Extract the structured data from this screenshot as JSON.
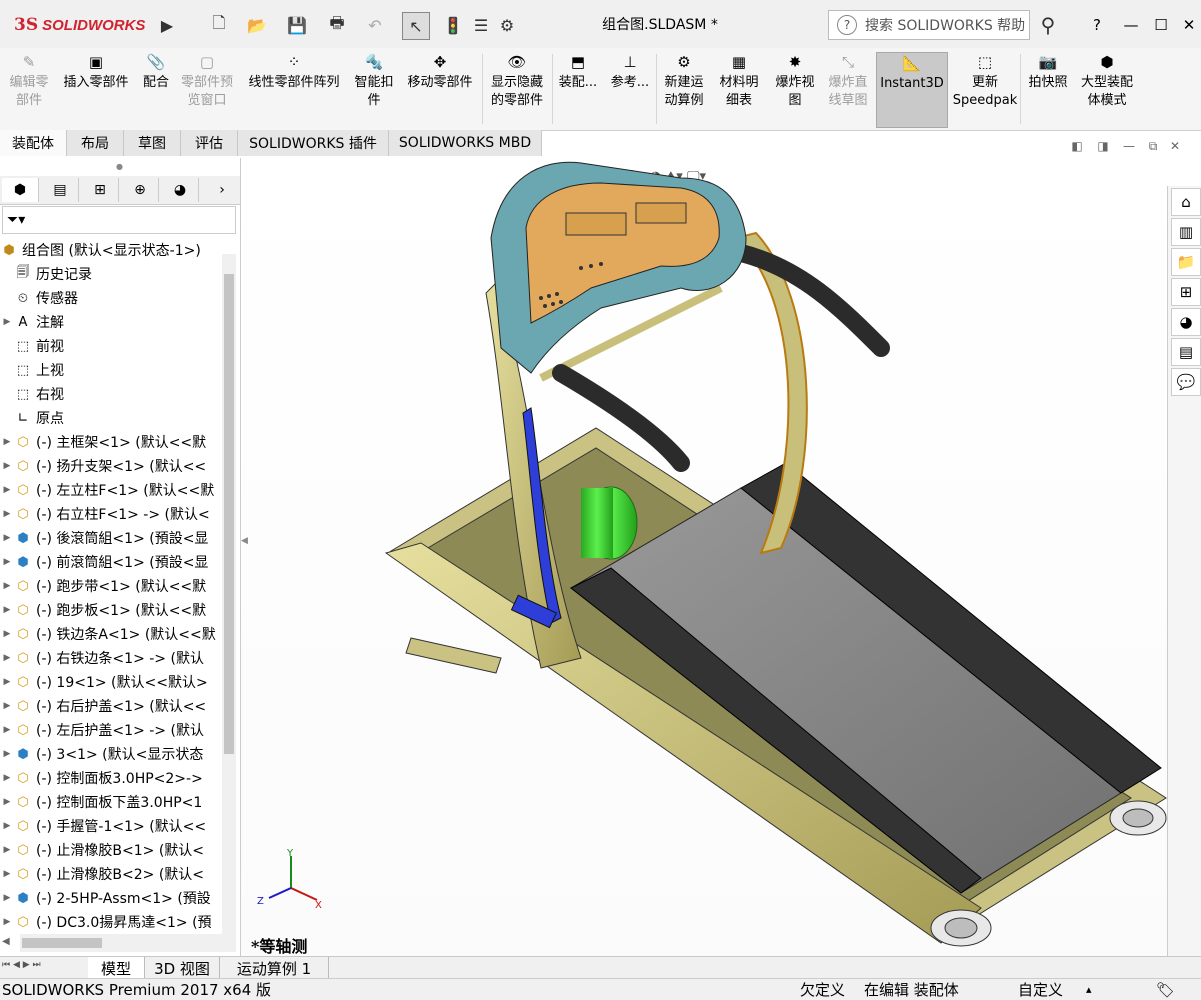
{
  "app": {
    "logo_prefix": "3S",
    "logo_word": "SOLIDWORKS",
    "document_title": "组合图.SLDASM *"
  },
  "search": {
    "placeholder": "搜索 SOLIDWORKS 帮助"
  },
  "window_controls": {
    "help": "?",
    "minimize": "—",
    "maximize": "☐",
    "close": "✕"
  },
  "commands": [
    {
      "label": "编辑零\n部件",
      "disabled": true
    },
    {
      "label": "插入零部件",
      "disabled": false
    },
    {
      "label": "配合",
      "disabled": false
    },
    {
      "label": "零部件预\n览窗口",
      "disabled": true
    },
    {
      "label": "线性零部件阵列",
      "disabled": false
    },
    {
      "label": "智能扣\n件",
      "disabled": false
    },
    {
      "label": "移动零部件",
      "disabled": false
    },
    {
      "label": "显示隐藏\n的零部件",
      "disabled": false
    },
    {
      "label": "装配...",
      "disabled": false
    },
    {
      "label": "参考...",
      "disabled": false
    },
    {
      "label": "新建运\n动算例",
      "disabled": false
    },
    {
      "label": "材料明\n细表",
      "disabled": false
    },
    {
      "label": "爆炸视\n图",
      "disabled": false
    },
    {
      "label": "爆炸直\n线草图",
      "disabled": true
    },
    {
      "label": "Instant3D",
      "disabled": false,
      "active": true
    },
    {
      "label": "更新\nSpeedpak",
      "disabled": false
    },
    {
      "label": "拍快照",
      "disabled": false
    },
    {
      "label": "大型装配\n体模式",
      "disabled": false
    }
  ],
  "tabs": [
    "装配体",
    "布局",
    "草图",
    "评估",
    "SOLIDWORKS 插件",
    "SOLIDWORKS MBD"
  ],
  "tree": {
    "root": "组合图 (默认<显示状态-1>)",
    "items": [
      {
        "label": "历史记录",
        "expandable": false,
        "icon": "history-icon"
      },
      {
        "label": "传感器",
        "expandable": false,
        "icon": "sensor-icon"
      },
      {
        "label": "注解",
        "expandable": true,
        "icon": "annotation-icon"
      },
      {
        "label": "前视",
        "expandable": false,
        "icon": "plane-icon"
      },
      {
        "label": "上视",
        "expandable": false,
        "icon": "plane-icon"
      },
      {
        "label": "右视",
        "expandable": false,
        "icon": "plane-icon"
      },
      {
        "label": "原点",
        "expandable": false,
        "icon": "origin-icon"
      },
      {
        "label": "(-) 主框架<1> (默认<<默",
        "expandable": true,
        "icon": "part-icon"
      },
      {
        "label": "(-) 扬升支架<1> (默认<<",
        "expandable": true,
        "icon": "part-icon"
      },
      {
        "label": "(-) 左立柱F<1> (默认<<默",
        "expandable": true,
        "icon": "part-icon"
      },
      {
        "label": "(-) 右立柱F<1> -> (默认<",
        "expandable": true,
        "icon": "part-icon"
      },
      {
        "label": "(-) 後滾筒組<1> (預設<显",
        "expandable": true,
        "icon": "assembly-icon"
      },
      {
        "label": "(-) 前滾筒組<1> (預設<显",
        "expandable": true,
        "icon": "assembly-icon"
      },
      {
        "label": "(-) 跑步带<1> (默认<<默",
        "expandable": true,
        "icon": "part-icon"
      },
      {
        "label": "(-) 跑步板<1> (默认<<默",
        "expandable": true,
        "icon": "part-icon"
      },
      {
        "label": "(-) 铁边条A<1> (默认<<默",
        "expandable": true,
        "icon": "part-icon"
      },
      {
        "label": "(-) 右铁边条<1> -> (默认",
        "expandable": true,
        "icon": "part-icon"
      },
      {
        "label": "(-) 19<1> (默认<<默认>",
        "expandable": true,
        "icon": "part-icon"
      },
      {
        "label": "(-) 右后护盖<1> (默认<<",
        "expandable": true,
        "icon": "part-icon"
      },
      {
        "label": "(-) 左后护盖<1> -> (默认",
        "expandable": true,
        "icon": "part-icon"
      },
      {
        "label": "(-) 3<1> (默认<显示状态",
        "expandable": true,
        "icon": "assembly-icon"
      },
      {
        "label": "(-) 控制面板3.0HP<2>->",
        "expandable": true,
        "icon": "part-icon"
      },
      {
        "label": "(-) 控制面板下盖3.0HP<1",
        "expandable": true,
        "icon": "part-icon"
      },
      {
        "label": "(-) 手握管-1<1> (默认<<",
        "expandable": true,
        "icon": "part-icon"
      },
      {
        "label": "(-) 止滑橡胶B<1> (默认<",
        "expandable": true,
        "icon": "part-icon"
      },
      {
        "label": "(-) 止滑橡胶B<2> (默认<",
        "expandable": true,
        "icon": "part-icon"
      },
      {
        "label": "(-) 2-5HP-Assm<1> (預設",
        "expandable": true,
        "icon": "assembly-icon"
      },
      {
        "label": "(-) DC3.0揚昇馬達<1> (預",
        "expandable": true,
        "icon": "part-icon"
      }
    ]
  },
  "viewport": {
    "view_label": "*等轴测",
    "axes": {
      "x": "X",
      "y": "Y",
      "z": "Z"
    }
  },
  "bottom_tabs": [
    "模型",
    "3D 视图",
    "运动算例 1"
  ],
  "status": {
    "product": "SOLIDWORKS Premium 2017 x64 版",
    "under_defined": "欠定义",
    "editing": "在编辑 装配体",
    "custom": "自定义"
  },
  "colors": {
    "accent_red": "#d1222f",
    "belt_gray": "#8a8a8a",
    "frame_olive": "#c8c07a",
    "console_orange": "#e2a95c",
    "console_teal": "#6aa7b0",
    "motor_green": "#35d22a",
    "panel_blue": "#2d3fd8"
  }
}
